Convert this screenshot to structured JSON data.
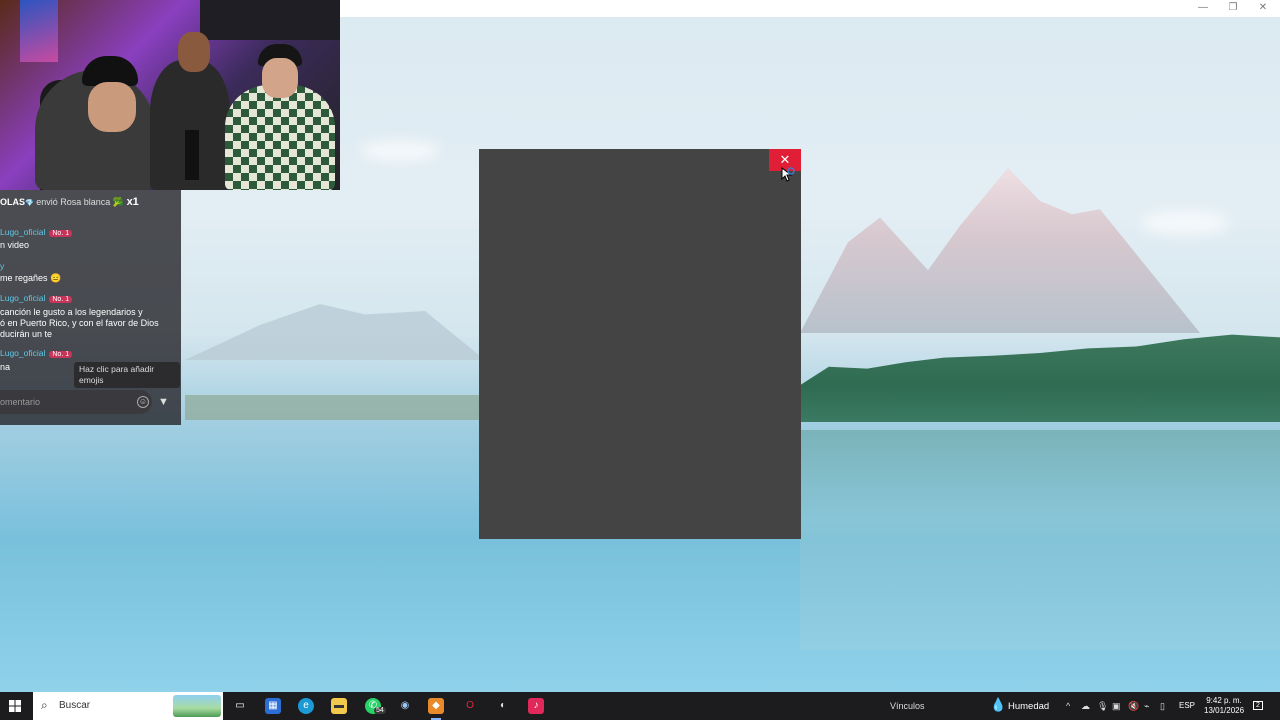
{
  "window": {
    "minimize": "—",
    "restore": "❐",
    "close": "✕"
  },
  "chat": {
    "gift": {
      "name": "OLAS",
      "gem": "💎",
      "text": "envió Rosa blanca",
      "emoji": "🥦",
      "count": "x1"
    },
    "messages": [
      {
        "user": "Lugo_oficial",
        "badge": "No. 1",
        "lines": [
          "n video"
        ]
      },
      {
        "user": "y",
        "badge": "",
        "lines": [
          "me regañes 😑"
        ]
      },
      {
        "user": "Lugo_oficial",
        "badge": "No. 1",
        "lines": [
          "canción le gusto a los legendarios y",
          "ó en Puerto Rico, y con el favor de Dios",
          "ducirán un te"
        ]
      },
      {
        "user": "Lugo_oficial",
        "badge": "No. 1",
        "lines": [
          "na"
        ]
      }
    ],
    "tooltip": "Haz clic para añadir emojis",
    "input_placeholder": "omentario"
  },
  "dialog": {
    "close_label": "✕"
  },
  "taskbar": {
    "search_label": "Buscar",
    "apps": [
      "task-view",
      "microsoft-store",
      "edge",
      "file-explorer",
      "whatsapp",
      "steam",
      "streaming-app",
      "opera",
      "obs",
      "tiktok"
    ],
    "whatsapp_badge": "54",
    "vinculos": "Vínculos",
    "weather": "Humedad",
    "language": "ESP",
    "time": "9:42 p. m.",
    "date": "13/01/2026",
    "notifications": "2"
  }
}
